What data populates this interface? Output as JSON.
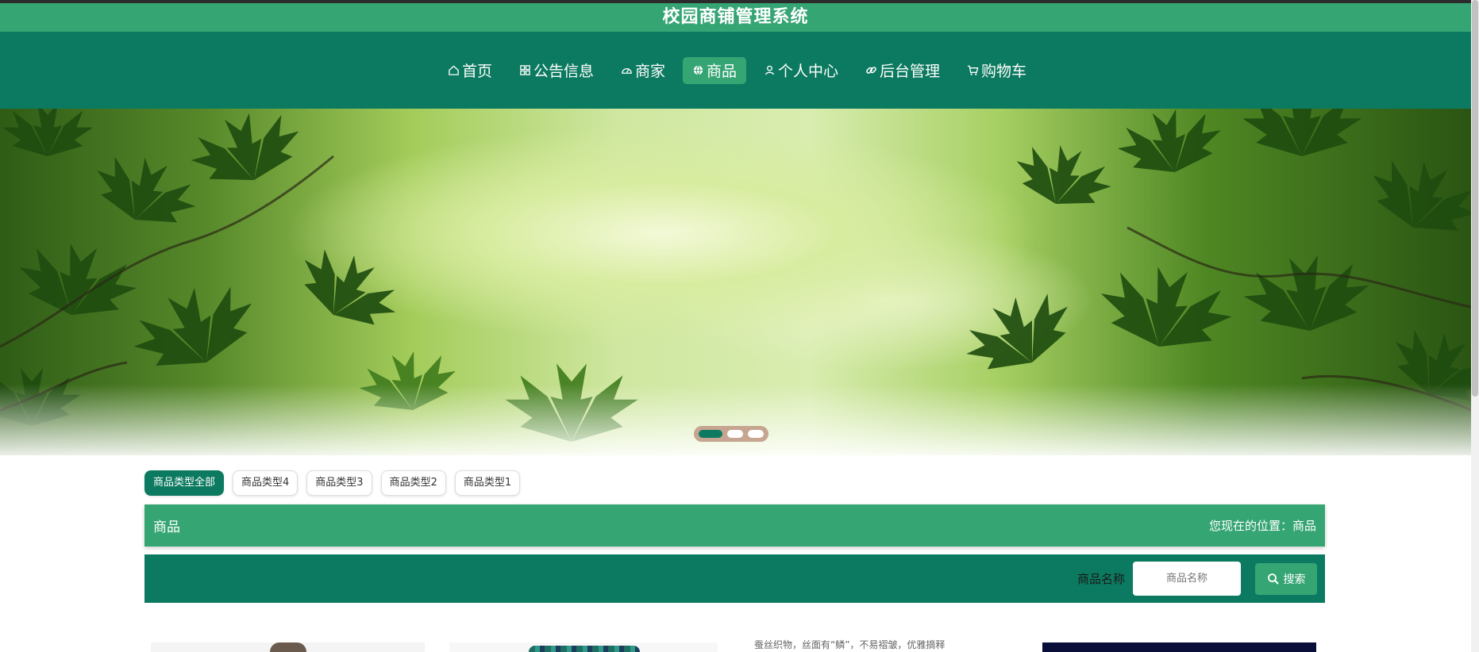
{
  "app": {
    "title": "校园商铺管理系统"
  },
  "nav": {
    "items": [
      {
        "label": "首页",
        "icon": "home-icon",
        "active": false
      },
      {
        "label": "公告信息",
        "icon": "grid-icon",
        "active": false
      },
      {
        "label": "商家",
        "icon": "gauge-icon",
        "active": false
      },
      {
        "label": "商品",
        "icon": "globe-icon",
        "active": true
      },
      {
        "label": "个人中心",
        "icon": "user-icon",
        "active": false
      },
      {
        "label": "后台管理",
        "icon": "link-icon",
        "active": false
      },
      {
        "label": "购物车",
        "icon": "cart-icon",
        "active": false
      }
    ]
  },
  "carousel": {
    "slide_count": 3,
    "active_index": 0
  },
  "categories": {
    "items": [
      {
        "label": "商品类型全部",
        "active": true
      },
      {
        "label": "商品类型4",
        "active": false
      },
      {
        "label": "商品类型3",
        "active": false
      },
      {
        "label": "商品类型2",
        "active": false
      },
      {
        "label": "商品类型1",
        "active": false
      }
    ]
  },
  "breadcrumb": {
    "title": "商品",
    "location": "您现在的位置：商品"
  },
  "search": {
    "label": "商品名称",
    "placeholder": "商品名称",
    "button_label": "搜索"
  },
  "products": {
    "snippet_text": "蚕丝织物，丝面有“鳞”，不易褶皱，优雅摘释"
  },
  "colors": {
    "primary": "#0c7a60",
    "accent": "#36a574",
    "carousel_dot_bg": "#be9682"
  }
}
